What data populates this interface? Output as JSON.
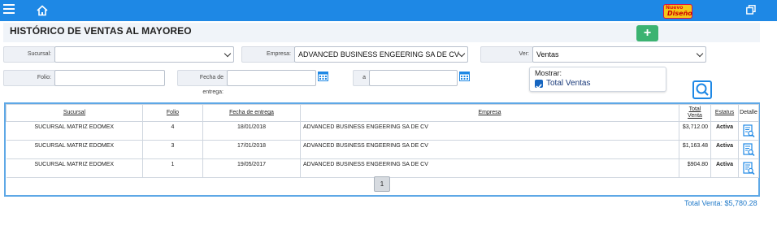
{
  "topbar": {
    "nuevo_line1": "Nuevo",
    "nuevo_line2": "Diseño",
    "icons": [
      "hamburger-menu-icon",
      "home-icon",
      "restore-window-icon"
    ]
  },
  "page": {
    "title": "HISTÓRICO DE VENTAS AL MAYOREO",
    "add_label": "+"
  },
  "filters": {
    "sucursal_label": "Sucursal:",
    "sucursal_value": "",
    "empresa_label": "Empresa:",
    "empresa_value": "ADVANCED BUSINESS ENGEERING SA DE CV",
    "ver_label": "Ver:",
    "ver_value": "Ventas",
    "folio_label": "Folio:",
    "folio_value": "",
    "fecha_label": "Fecha de entrega:",
    "fecha_from": "",
    "a_label": "a",
    "fecha_to": ""
  },
  "mostrar": {
    "label": "Mostrar:",
    "total_ventas_label": "Total Ventas",
    "total_ventas_checked": true
  },
  "table": {
    "headers": {
      "sucursal": "Sucursal",
      "folio": "Folio",
      "fecha": "Fecha de entrega",
      "empresa": "Empresa",
      "total_line1": "Total",
      "total_line2": "Venta",
      "estatus": "Estatus",
      "detalle": "Detalle"
    },
    "rows": [
      {
        "sucursal": "SUCURSAL MATRIZ EDOMEX",
        "folio": "4",
        "fecha": "18/01/2018",
        "empresa": "ADVANCED BUSINESS ENGEERING SA DE CV",
        "total": "$3,712.00",
        "estatus": "Activa"
      },
      {
        "sucursal": "SUCURSAL MATRIZ EDOMEX",
        "folio": "3",
        "fecha": "17/01/2018",
        "empresa": "ADVANCED BUSINESS ENGEERING SA DE CV",
        "total": "$1,163.48",
        "estatus": "Activa"
      },
      {
        "sucursal": "SUCURSAL MATRIZ EDOMEX",
        "folio": "1",
        "fecha": "19/05/2017",
        "empresa": "ADVANCED BUSINESS ENGEERING SA DE CV",
        "total": "$904.80",
        "estatus": "Activa"
      }
    ]
  },
  "pager": {
    "current_page": "1"
  },
  "summary": {
    "total_venta": "Total Venta: $5,780.28"
  },
  "colors": {
    "topbar": "#1e88e5",
    "add_button": "#3cb371",
    "grid_border": "#5ea8e6",
    "activa": "#2e8b3a",
    "total_text": "#1e78c8"
  }
}
